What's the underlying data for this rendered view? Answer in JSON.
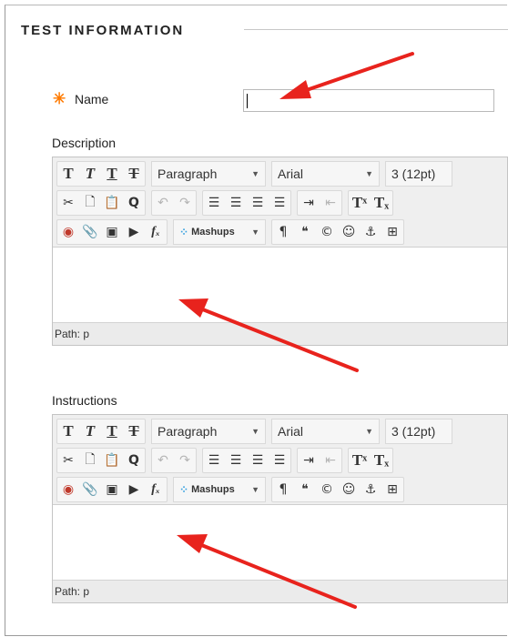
{
  "section": {
    "title": "TEST INFORMATION"
  },
  "name_field": {
    "required_mark": "✳",
    "label": "Name",
    "value": "",
    "placeholder": ""
  },
  "description": {
    "label": "Description",
    "path_label": "Path: p"
  },
  "instructions": {
    "label": "Instructions",
    "path_label": "Path: p"
  },
  "toolbar": {
    "format_select": "Paragraph",
    "font_select": "Arial",
    "size_select": "3 (12pt)",
    "mashups": "Mashups",
    "row1_icons": [
      "T",
      "T",
      "T",
      "T"
    ],
    "colors": {
      "arrow": "#e8231d",
      "required": "#ff7a00"
    }
  }
}
